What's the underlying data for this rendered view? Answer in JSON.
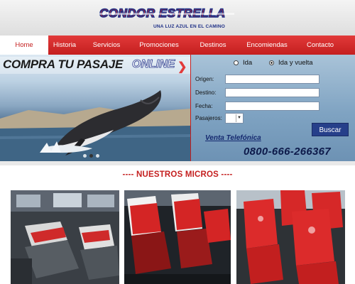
{
  "brand": {
    "name": "CONDOR ESTRELLA",
    "slogan": "UNA LUZ AZUL EN EL CAMINO"
  },
  "nav": {
    "items": [
      {
        "label": "Home",
        "active": true
      },
      {
        "label": "Historia"
      },
      {
        "label": "Servicios"
      },
      {
        "label": "Promociones"
      },
      {
        "label": "Destinos"
      },
      {
        "label": "Encomiendas"
      },
      {
        "label": "Contacto"
      }
    ]
  },
  "banner": {
    "promo_text": "COMPRA TU PASAJE",
    "promo_online": "ONLINE",
    "slides_total": 3,
    "slide_active": 1
  },
  "booking": {
    "trip_options": [
      {
        "label": "Ida",
        "selected": false
      },
      {
        "label": "Ida y vuelta",
        "selected": false
      }
    ],
    "fields": [
      {
        "label": "Origen:",
        "value": ""
      },
      {
        "label": "Destino:",
        "value": ""
      },
      {
        "label": "Fecha:",
        "value": ""
      }
    ],
    "passengers_label": "Pasajeros:",
    "passengers_value": "",
    "search_label": "Buscar",
    "phone_title": "Venta Telefónica",
    "phone_number": "0800-666-266367"
  },
  "section": {
    "title": "---- NUESTROS MICROS ----"
  },
  "colors": {
    "brand_red": "#c41f1f",
    "brand_blue": "#1d2f86",
    "button_blue": "#263f8a"
  }
}
